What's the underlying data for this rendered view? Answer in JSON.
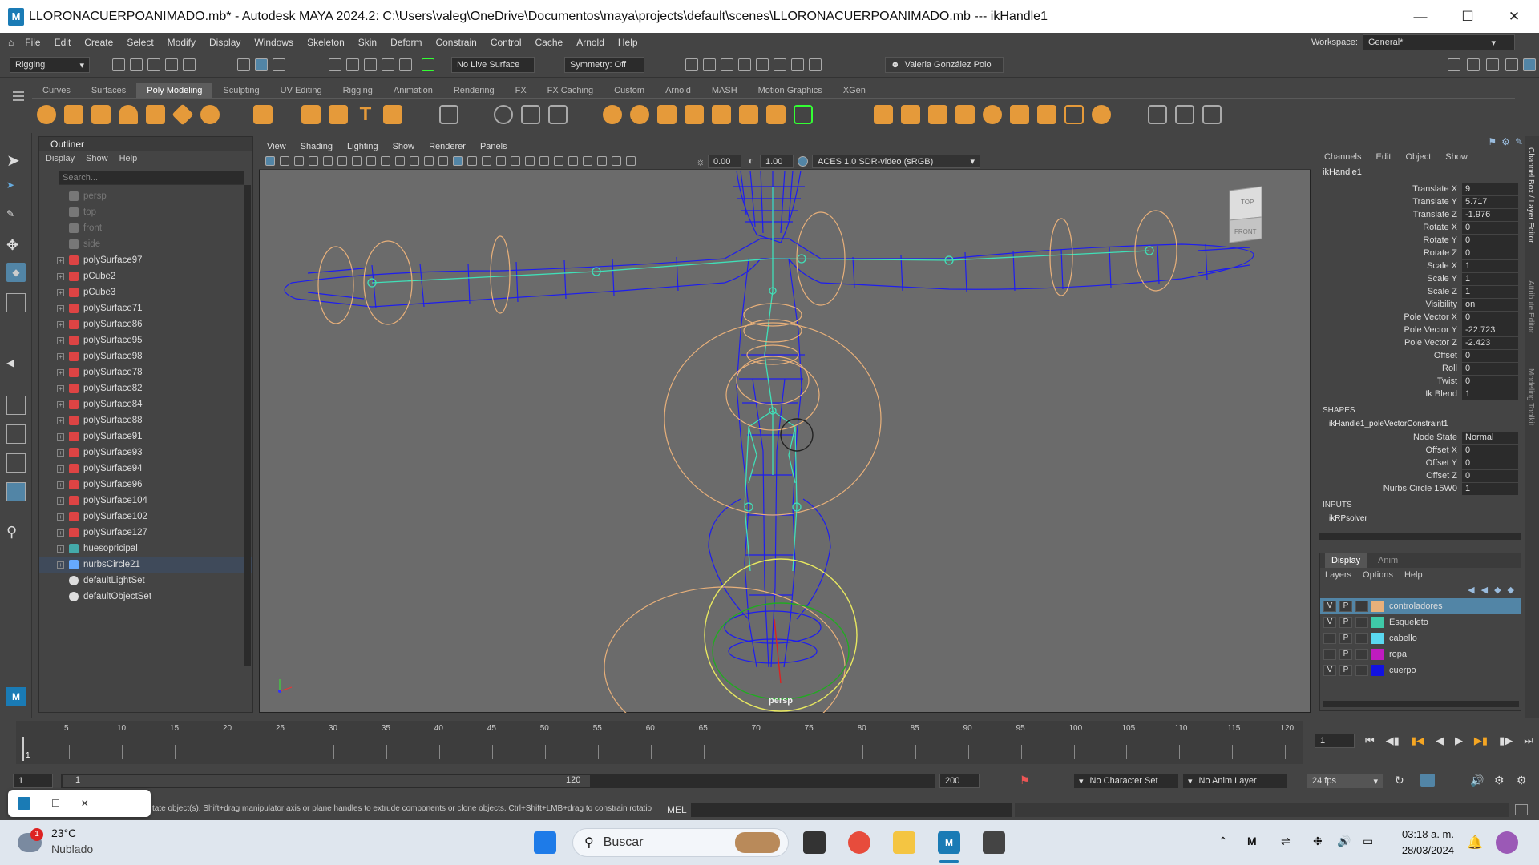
{
  "window": {
    "title": "LLORONACUERPOANIMADO.mb* - Autodesk MAYA 2024.2: C:\\Users\\valeg\\OneDrive\\Documentos\\maya\\projects\\default\\scenes\\LLORONACUERPOANIMADO.mb   ---   ikHandle1",
    "logo": "M"
  },
  "menu": [
    "File",
    "Edit",
    "Create",
    "Select",
    "Modify",
    "Display",
    "Windows",
    "Skeleton",
    "Skin",
    "Deform",
    "Constrain",
    "Control",
    "Cache",
    "Arnold",
    "Help"
  ],
  "workspace": {
    "label": "Workspace:",
    "value": "General*"
  },
  "statusline": {
    "mode": "Rigging",
    "live_surface": "No Live Surface",
    "symmetry": "Symmetry: Off",
    "user": "Valeria González Polo"
  },
  "shelf_tabs": [
    "Curves",
    "Surfaces",
    "Poly Modeling",
    "Sculpting",
    "UV Editing",
    "Rigging",
    "Animation",
    "Rendering",
    "FX",
    "FX Caching",
    "Custom",
    "Arnold",
    "MASH",
    "Motion Graphics",
    "XGen"
  ],
  "shelf_active": "Poly Modeling",
  "outliner": {
    "title": "Outliner",
    "menu": [
      "Display",
      "Show",
      "Help"
    ],
    "search_placeholder": "Search...",
    "items": [
      {
        "label": "persp",
        "kind": "camera"
      },
      {
        "label": "top",
        "kind": "camera"
      },
      {
        "label": "front",
        "kind": "camera"
      },
      {
        "label": "side",
        "kind": "camera"
      },
      {
        "label": "polySurface97",
        "kind": "mesh"
      },
      {
        "label": "pCube2",
        "kind": "mesh"
      },
      {
        "label": "pCube3",
        "kind": "mesh"
      },
      {
        "label": "polySurface71",
        "kind": "mesh"
      },
      {
        "label": "polySurface86",
        "kind": "mesh"
      },
      {
        "label": "polySurface95",
        "kind": "mesh"
      },
      {
        "label": "polySurface98",
        "kind": "mesh"
      },
      {
        "label": "polySurface78",
        "kind": "mesh"
      },
      {
        "label": "polySurface82",
        "kind": "mesh"
      },
      {
        "label": "polySurface84",
        "kind": "mesh"
      },
      {
        "label": "polySurface88",
        "kind": "mesh"
      },
      {
        "label": "polySurface91",
        "kind": "mesh"
      },
      {
        "label": "polySurface93",
        "kind": "mesh"
      },
      {
        "label": "polySurface94",
        "kind": "mesh"
      },
      {
        "label": "polySurface96",
        "kind": "mesh"
      },
      {
        "label": "polySurface104",
        "kind": "mesh"
      },
      {
        "label": "polySurface102",
        "kind": "mesh"
      },
      {
        "label": "polySurface127",
        "kind": "mesh"
      },
      {
        "label": "huesopricipal",
        "kind": "joint"
      },
      {
        "label": "nurbsCircle21",
        "kind": "curve"
      },
      {
        "label": "defaultLightSet",
        "kind": "set"
      },
      {
        "label": "defaultObjectSet",
        "kind": "set"
      }
    ]
  },
  "viewport": {
    "menu": [
      "View",
      "Shading",
      "Lighting",
      "Show",
      "Renderer",
      "Panels"
    ],
    "field1": "0.00",
    "field2": "1.00",
    "colorspace": "ACES 1.0 SDR-video (sRGB)",
    "camera": "persp",
    "cube_top": "TOP",
    "cube_front": "FRONT"
  },
  "channel_box": {
    "tabs": [
      "Channels",
      "Edit",
      "Object",
      "Show"
    ],
    "node": "ikHandle1",
    "attributes": [
      {
        "label": "Translate X",
        "value": "9"
      },
      {
        "label": "Translate Y",
        "value": "5.717"
      },
      {
        "label": "Translate Z",
        "value": "-1.976"
      },
      {
        "label": "Rotate X",
        "value": "0"
      },
      {
        "label": "Rotate Y",
        "value": "0"
      },
      {
        "label": "Rotate Z",
        "value": "0"
      },
      {
        "label": "Scale X",
        "value": "1"
      },
      {
        "label": "Scale Y",
        "value": "1"
      },
      {
        "label": "Scale Z",
        "value": "1"
      },
      {
        "label": "Visibility",
        "value": "on"
      },
      {
        "label": "Pole Vector X",
        "value": "0"
      },
      {
        "label": "Pole Vector Y",
        "value": "-22.723"
      },
      {
        "label": "Pole Vector Z",
        "value": "-2.423"
      },
      {
        "label": "Offset",
        "value": "0"
      },
      {
        "label": "Roll",
        "value": "0"
      },
      {
        "label": "Twist",
        "value": "0"
      },
      {
        "label": "Ik Blend",
        "value": "1"
      }
    ],
    "shapes_header": "SHAPES",
    "shape_node": "ikHandle1_poleVectorConstraint1",
    "shape_attributes": [
      {
        "label": "Node State",
        "value": "Normal"
      },
      {
        "label": "Offset X",
        "value": "0"
      },
      {
        "label": "Offset Y",
        "value": "0"
      },
      {
        "label": "Offset Z",
        "value": "0"
      },
      {
        "label": "Nurbs Circle 15W0",
        "value": "1"
      }
    ],
    "inputs_header": "INPUTS",
    "input_node": "ikRPsolver"
  },
  "layer_editor": {
    "tabs": [
      "Display",
      "Anim"
    ],
    "menu": [
      "Layers",
      "Options",
      "Help"
    ],
    "layers": [
      {
        "v": "V",
        "p": "P",
        "name": "controladores",
        "color": "#e8b07a",
        "selected": true
      },
      {
        "v": "V",
        "p": "P",
        "name": "Esqueleto",
        "color": "#3fc9a8",
        "selected": false
      },
      {
        "v": "",
        "p": "P",
        "name": "cabello",
        "color": "#5ad8f0",
        "selected": false
      },
      {
        "v": "",
        "p": "P",
        "name": "ropa",
        "color": "#c01bc0",
        "selected": false
      },
      {
        "v": "V",
        "p": "P",
        "name": "cuerpo",
        "color": "#1212e0",
        "selected": false
      }
    ]
  },
  "side_tabs": [
    "Channel Box / Layer Editor",
    "Attribute Editor",
    "Modeling Toolkit"
  ],
  "timeline": {
    "ticks": [
      "5",
      "10",
      "15",
      "20",
      "25",
      "30",
      "35",
      "40",
      "45",
      "50",
      "55",
      "60",
      "65",
      "70",
      "75",
      "80",
      "85",
      "90",
      "95",
      "100",
      "105",
      "110",
      "115",
      "120"
    ],
    "current_frame": "1",
    "left_label": "1"
  },
  "range": {
    "start": "1",
    "inner_start": "1",
    "inner_end": "120",
    "end": "200",
    "character_set": "No Character Set",
    "anim_layer": "No Anim Layer",
    "fps": "24 fps"
  },
  "command": {
    "help_text": "tate object(s). Shift+drag manipulator axis or plane handles to extrude components or clone objects. Ctrl+Shift+LMB+drag to constrain rotatio",
    "lang": "MEL"
  },
  "taskbar": {
    "weather_temp": "23°C",
    "weather_desc": "Nublado",
    "weather_badge": "1",
    "search_label": "Buscar",
    "time": "03:18 a. m.",
    "date": "28/03/2024"
  }
}
